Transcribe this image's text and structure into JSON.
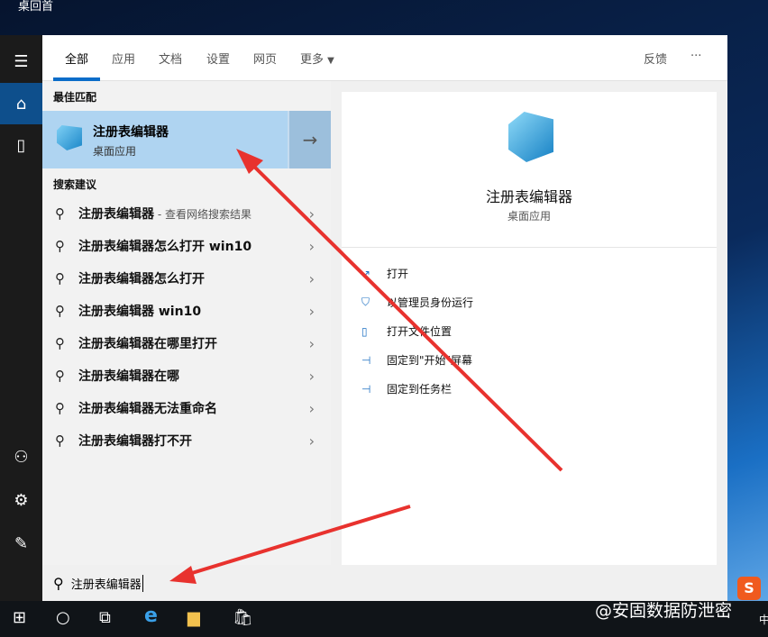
{
  "desktop": {
    "label": "桌回首"
  },
  "tabs": [
    "全部",
    "应用",
    "文档",
    "设置",
    "网页",
    "更多"
  ],
  "feedback": "反馈",
  "more_dots": "···",
  "best_match": {
    "header": "最佳匹配",
    "title": "注册表编辑器",
    "subtitle": "桌面应用"
  },
  "suggestions_header": "搜索建议",
  "suggestions": [
    {
      "text": "注册表编辑器",
      "suffix": " - 查看网络搜索结果"
    },
    {
      "text": "注册表编辑器怎么打开 win10"
    },
    {
      "text": "注册表编辑器怎么打开"
    },
    {
      "text": "注册表编辑器 win10"
    },
    {
      "text": "注册表编辑器在哪里打开"
    },
    {
      "text": "注册表编辑器在哪"
    },
    {
      "text": "注册表编辑器无法重命名"
    },
    {
      "text": "注册表编辑器打不开"
    }
  ],
  "preview": {
    "title": "注册表编辑器",
    "subtitle": "桌面应用",
    "actions": [
      "打开",
      "以管理员身份运行",
      "打开文件位置",
      "固定到\"开始\"屏幕",
      "固定到任务栏"
    ]
  },
  "search": {
    "value": "注册表编辑器"
  },
  "watermark": "@安固数据防泄密",
  "ime": "中"
}
